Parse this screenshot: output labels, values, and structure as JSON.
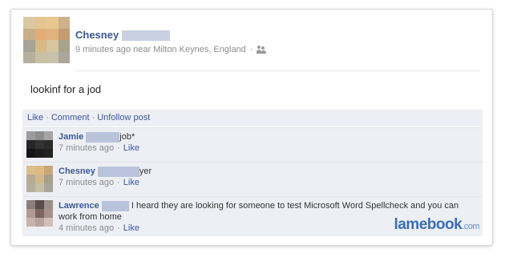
{
  "post": {
    "author": "Chesney",
    "time": "9 minutes ago near Milton Keynes, England",
    "separator": "·",
    "text": "lookinf for a jod"
  },
  "actions": {
    "like": "Like",
    "comment": "Comment",
    "unfollow": "Unfollow post",
    "separator": "·"
  },
  "comments": [
    {
      "name": "Jamie",
      "text": "job*",
      "time": "7 minutes ago",
      "like": "Like"
    },
    {
      "name": "Chesney",
      "text": "yer",
      "time": "7 minutes ago",
      "like": "Like"
    },
    {
      "name": "Lawrence",
      "text": "I heard they are looking for someone to test Microsoft Word Spellcheck and you can work from home",
      "time": "4 minutes ago",
      "like": "Like"
    }
  ],
  "watermark": {
    "main": "lamebook",
    "suffix": ".com"
  },
  "colors": {
    "link": "#3b5998",
    "meta": "#8c8c8c",
    "comment_bg": "#edeff4"
  },
  "icons": {
    "audience": "friends-icon"
  }
}
